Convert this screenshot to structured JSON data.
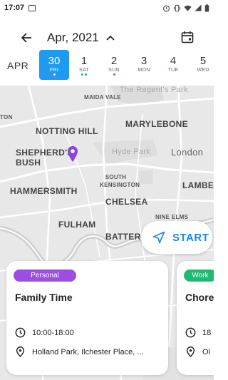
{
  "status_bar": {
    "time": "17:07"
  },
  "header": {
    "month_title": "Apr, 2021",
    "month_short": "APR",
    "days": [
      {
        "num": "30",
        "name": "FRI",
        "selected": true
      },
      {
        "num": "1",
        "name": "SAT",
        "selected": false
      },
      {
        "num": "2",
        "name": "SUN",
        "selected": false
      },
      {
        "num": "3",
        "name": "MON",
        "selected": false
      },
      {
        "num": "4",
        "name": "TUE",
        "selected": false
      },
      {
        "num": "5",
        "name": "WED",
        "selected": false
      }
    ]
  },
  "map": {
    "labels": {
      "maida_vale": "MAIDA VALE",
      "regents_park": "The Regent's Park",
      "notting_hill": "NOTTING HILL",
      "marylebone": "MARYLEBONE",
      "shepherds_bush": "SHEPHERD'S BUSH",
      "hyde_park": "Hyde Park",
      "london": "London",
      "south_kensington": "SOUTH KENSINGTON",
      "hammersmith": "HAMMERSMITH",
      "lambeth": "LAMBET",
      "chelsea": "CHELSEA",
      "nine_elms": "NINE ELMS",
      "fulham": "FULHAM",
      "battersea": "BATTERS",
      "ton": "TON"
    }
  },
  "start_button": {
    "label": "START"
  },
  "events": [
    {
      "tag": "Personal",
      "title": "Family Time",
      "time": "10:00-18:00",
      "location": "Holland Park, Ilchester Place, ..."
    },
    {
      "tag": "Work",
      "title": "Chore",
      "time": "18",
      "location": "Ol"
    }
  ],
  "colors": {
    "accent_blue": "#1e9bf0",
    "personal_tag": "#9c4ee0",
    "work_tag": "#21b872",
    "pin": "#8e44d6"
  }
}
